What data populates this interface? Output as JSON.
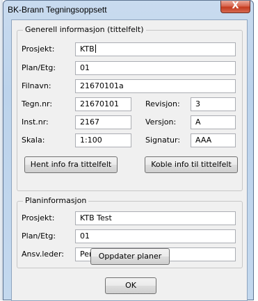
{
  "window": {
    "title": "BK-Brann Tegningsoppsett",
    "close_glyph": "X"
  },
  "general": {
    "legend": "Generell informasjon (tittelfelt)",
    "prosjekt_label": "Prosjekt:",
    "prosjekt_value": "KTB",
    "plan_label": "Plan/Etg:",
    "plan_value": "01",
    "filnavn_label": "Filnavn:",
    "filnavn_value": "21670101a",
    "tegn_label": "Tegn.nr:",
    "tegn_value": "21670101",
    "revisjon_label": "Revisjon:",
    "revisjon_value": "3",
    "inst_label": "Inst.nr:",
    "inst_value": "2167",
    "versjon_label": "Versjon:",
    "versjon_value": "A",
    "skala_label": "Skala:",
    "skala_value": "1:100",
    "signatur_label": "Signatur:",
    "signatur_value": "AAA",
    "hent_button": "Hent info fra tittelfelt",
    "koble_button": "Koble info til tittelfelt"
  },
  "plan": {
    "legend": "Planinformasjon",
    "prosjekt_label": "Prosjekt:",
    "prosjekt_value": "KTB Test",
    "plan_label": "Plan/Etg:",
    "plan_value": "01",
    "ansv_label": "Ansv.leder:",
    "ansv_value": "Per",
    "oppdater_button": "Oppdater planer"
  },
  "ok_button": "OK"
}
